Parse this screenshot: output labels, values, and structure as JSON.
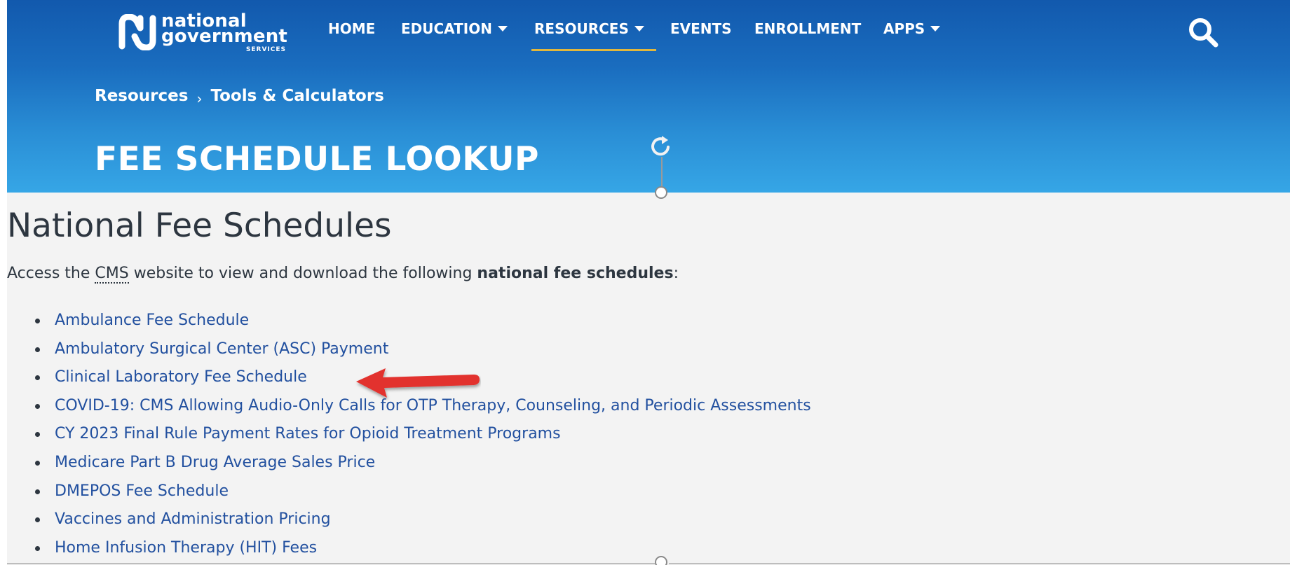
{
  "logo": {
    "line1": "national",
    "line2": "government",
    "line3": "SERVICES"
  },
  "nav": {
    "items": [
      {
        "label": "HOME",
        "has_dropdown": false
      },
      {
        "label": "EDUCATION",
        "has_dropdown": true
      },
      {
        "label": "RESOURCES",
        "has_dropdown": true,
        "active": true
      },
      {
        "label": "EVENTS",
        "has_dropdown": false
      },
      {
        "label": "ENROLLMENT",
        "has_dropdown": false
      },
      {
        "label": "APPS",
        "has_dropdown": true
      }
    ],
    "search_icon": "search-icon"
  },
  "breadcrumb": {
    "items": [
      "Resources",
      "Tools & Calculators"
    ],
    "separator": "›"
  },
  "hero": {
    "title": "FEE SCHEDULE LOOKUP"
  },
  "content": {
    "heading": "National Fee Schedules",
    "intro_prefix": "Access the ",
    "intro_abbr": "CMS",
    "intro_middle": " website to view and download the following ",
    "intro_bold": "national fee schedules",
    "intro_suffix": ":",
    "links": [
      "Ambulance Fee Schedule",
      "Ambulatory Surgical Center (ASC) Payment",
      "Clinical Laboratory Fee Schedule",
      "COVID-19: CMS Allowing Audio-Only Calls for OTP Therapy, Counseling, and Periodic Assessments",
      "CY 2023 Final Rule Payment Rates for Opioid Treatment Programs",
      "Medicare Part B Drug Average Sales Price",
      "DMEPOS Fee Schedule",
      "Vaccines and Administration Pricing",
      "Home Infusion Therapy (HIT) Fees"
    ]
  },
  "colors": {
    "header_top": "#1259ad",
    "header_bottom": "#36a6e6",
    "nav_active_underline": "#e2b73c",
    "link": "#22509f",
    "text": "#2d3640",
    "annotation_arrow": "#e2302d"
  }
}
